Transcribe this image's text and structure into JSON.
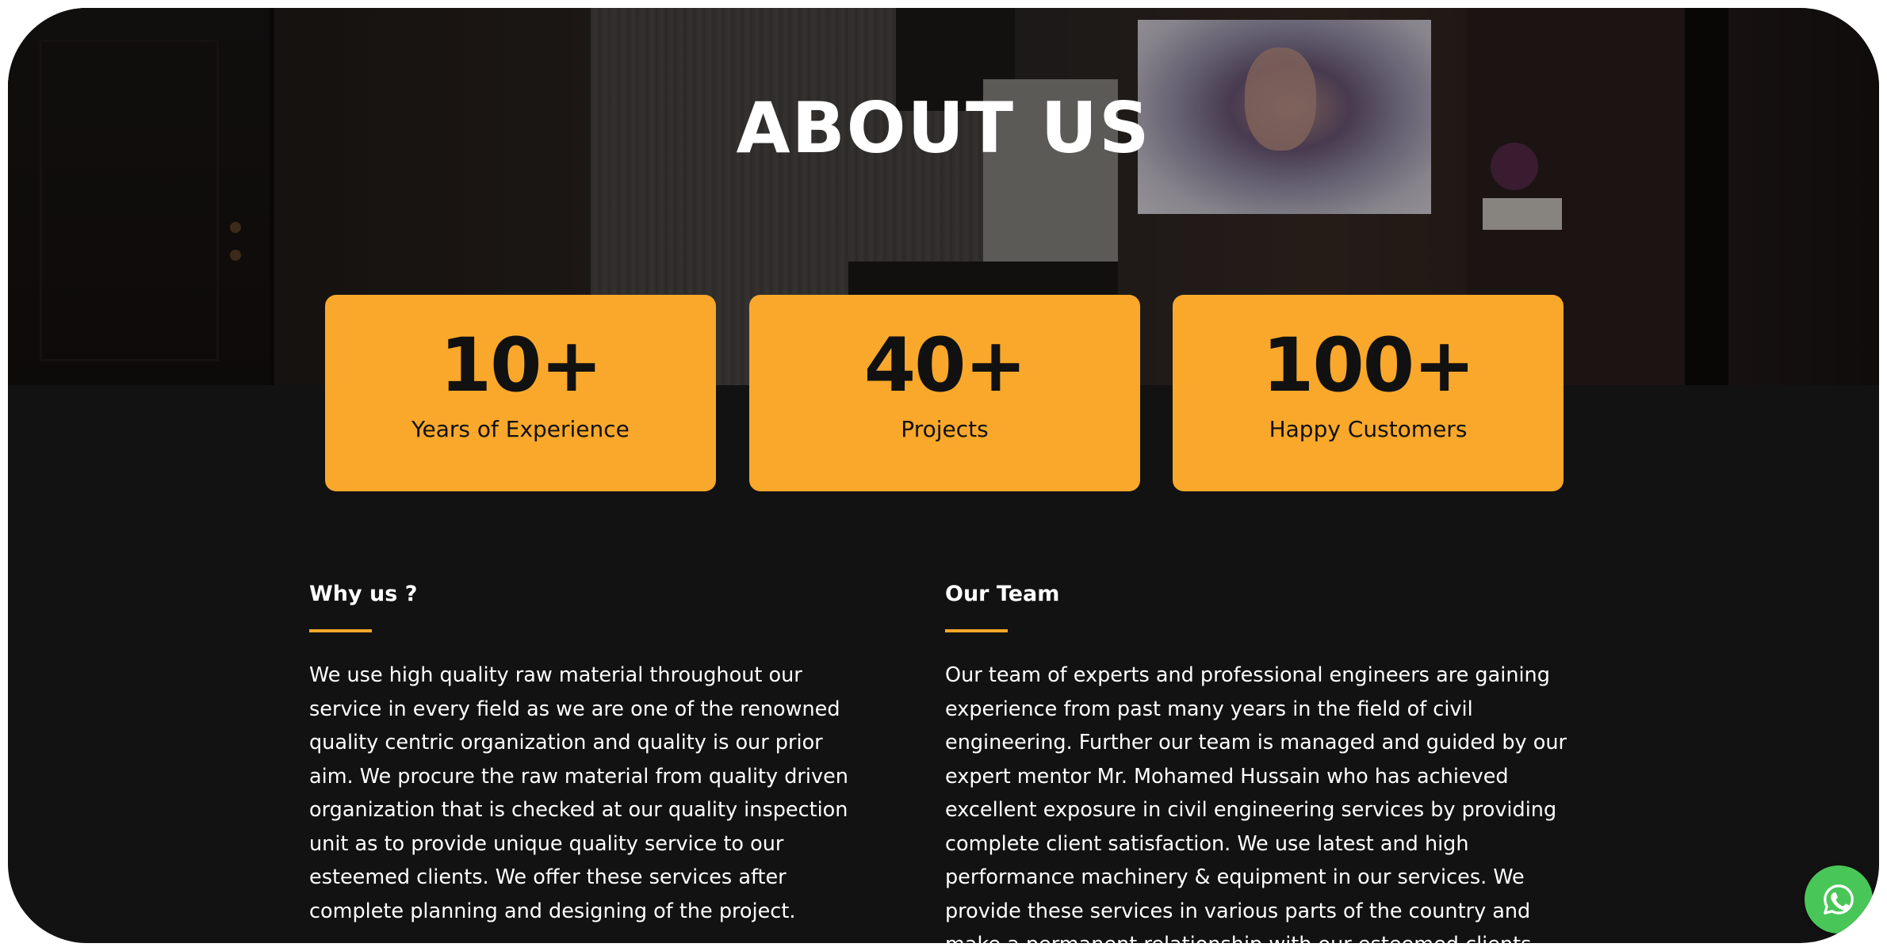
{
  "hero": {
    "title": "ABOUT US"
  },
  "stats": [
    {
      "value": "10+",
      "label": "Years of Experience"
    },
    {
      "value": "40+",
      "label": "Projects"
    },
    {
      "value": "100+",
      "label": "Happy Customers"
    }
  ],
  "why_us": {
    "heading": "Why us ?",
    "body": "We use high quality raw material throughout our service in every field as we are one of the renowned quality centric organization and quality is our prior aim. We procure the raw material from quality driven organization that is checked at our quality inspection unit as to provide unique quality service to our esteemed clients. We offer these services after complete planning and designing of the project."
  },
  "our_team": {
    "heading": "Our Team",
    "body": "Our team of experts and professional engineers are gaining experience from past many years in the field of civil engineering. Further our team is managed and guided by our expert mentor Mr. Mohamed Hussain who has achieved excellent exposure in civil engineering services by providing complete client satisfaction. We use latest and high performance machinery & equipment in our services. We provide these services in various parts of the country and make a permanent relationship with our esteemed clients."
  },
  "icons": {
    "whatsapp": "whatsapp-icon"
  },
  "colors": {
    "accent": "#f9a82b",
    "background": "#121212",
    "whatsapp": "#49c658"
  }
}
